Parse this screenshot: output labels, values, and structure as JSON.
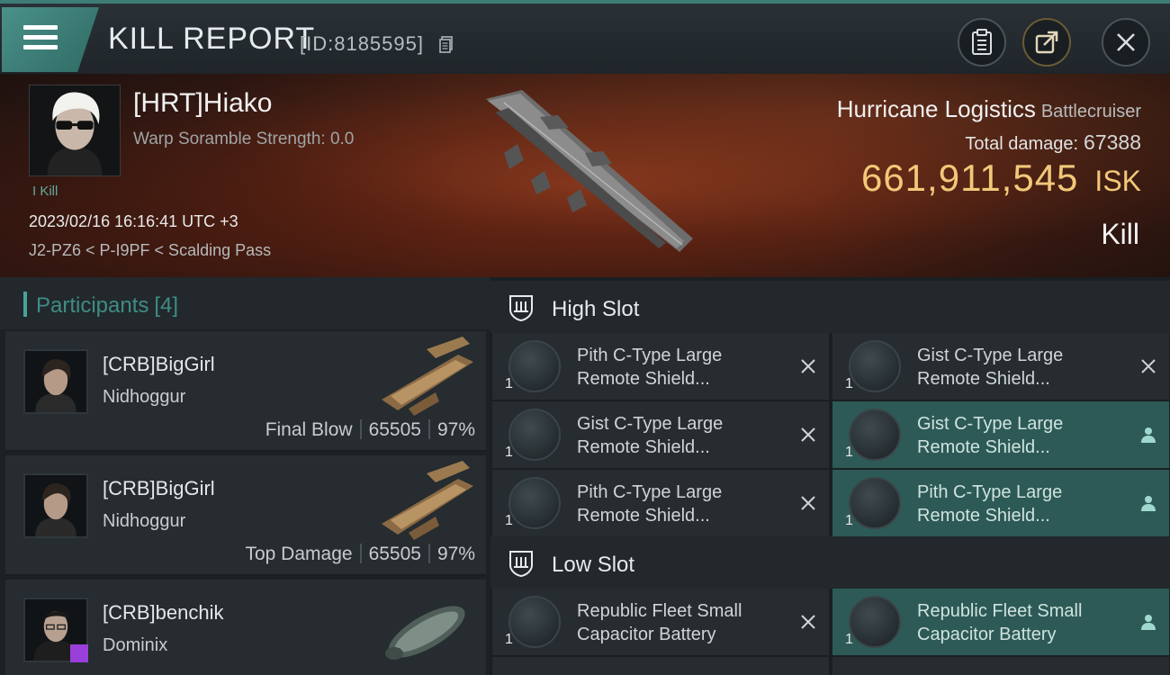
{
  "header": {
    "title": "KILL REPORT",
    "kill_id": "[ID:8185595]",
    "buttons": [
      "menu-icon",
      "clipboard-icon",
      "share-icon",
      "close-icon"
    ]
  },
  "victim": {
    "name": "[HRT]Hiako",
    "scramble": "Warp Soramble Strength: 0.0",
    "tag": "I Kill",
    "time": "2023/02/16 16:16:41 UTC +3",
    "location": "J2-PZ6 < P-I9PF < Scalding Pass",
    "ship_name": "Hurricane Logistics",
    "ship_class": "Battlecruiser",
    "total_damage_label": "Total damage:",
    "total_damage": "67388",
    "isk_value": "661,911,545",
    "isk_unit": "ISK",
    "result": "Kill"
  },
  "participants": {
    "title": "Participants",
    "count": "[4]",
    "rows": [
      {
        "name": "[CRB]BigGirl",
        "ship": "Nidhoggur",
        "label": "Final Blow",
        "damage": "65505",
        "percent": "97%"
      },
      {
        "name": "[CRB]BigGirl",
        "ship": "Nidhoggur",
        "label": "Top Damage",
        "damage": "65505",
        "percent": "97%"
      },
      {
        "name": "[CRB]benchik",
        "ship": "Dominix",
        "label": "",
        "damage": "",
        "percent": ""
      }
    ]
  },
  "high_slot": {
    "title": "High Slot",
    "items": [
      {
        "qty": "1",
        "line1": "Pith C-Type Large",
        "line2": "Remote Shield..."
      },
      {
        "qty": "1",
        "line1": "Gist C-Type Large",
        "line2": "Remote Shield..."
      },
      {
        "qty": "1",
        "line1": "Gist C-Type Large",
        "line2": "Remote Shield..."
      },
      {
        "qty": "1",
        "line1": "Gist C-Type Large",
        "line2": "Remote Shield..."
      },
      {
        "qty": "1",
        "line1": "Pith C-Type Large",
        "line2": "Remote Shield..."
      },
      {
        "qty": "1",
        "line1": "Pith C-Type Large",
        "line2": "Remote Shield..."
      }
    ]
  },
  "low_slot": {
    "title": "Low Slot",
    "items": [
      {
        "qty": "1",
        "line1": "Republic Fleet Small",
        "line2": "Capacitor Battery"
      },
      {
        "qty": "1",
        "line1": "Republic Fleet Small",
        "line2": "Capacitor Battery"
      }
    ]
  },
  "colors": {
    "accent": "#47a398",
    "isk": "#f2c879",
    "dropped": "#2d5a56"
  }
}
